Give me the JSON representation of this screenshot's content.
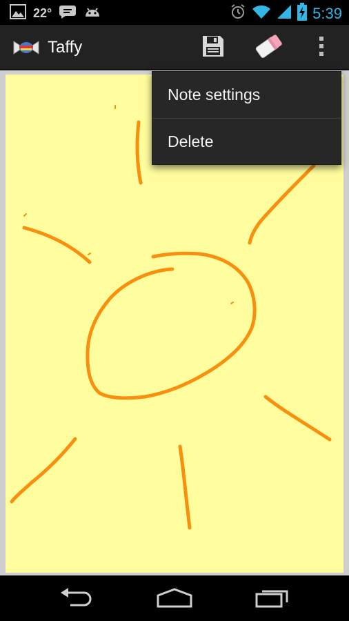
{
  "status_bar": {
    "temperature": "22°",
    "time": "5:39",
    "icons": [
      "picture-icon",
      "chat-icon",
      "android-icon",
      "alarm-icon",
      "wifi-icon",
      "signal-icon",
      "battery-charging-icon"
    ]
  },
  "action_bar": {
    "title": "Taffy",
    "icons": [
      "taffy-candy-icon",
      "save-icon",
      "eraser-icon",
      "overflow-menu-icon"
    ]
  },
  "menu": {
    "items": [
      {
        "label": "Note settings"
      },
      {
        "label": "Delete"
      }
    ]
  },
  "note": {
    "paper_color": "#fffd9e",
    "ink_color": "#f7900f"
  },
  "nav_bar": {
    "icons": [
      "back-icon",
      "home-icon",
      "recent-apps-icon"
    ]
  },
  "colors": {
    "status_time": "#33b5e5",
    "action_bar": "#222222",
    "menu_background": "#272727"
  }
}
